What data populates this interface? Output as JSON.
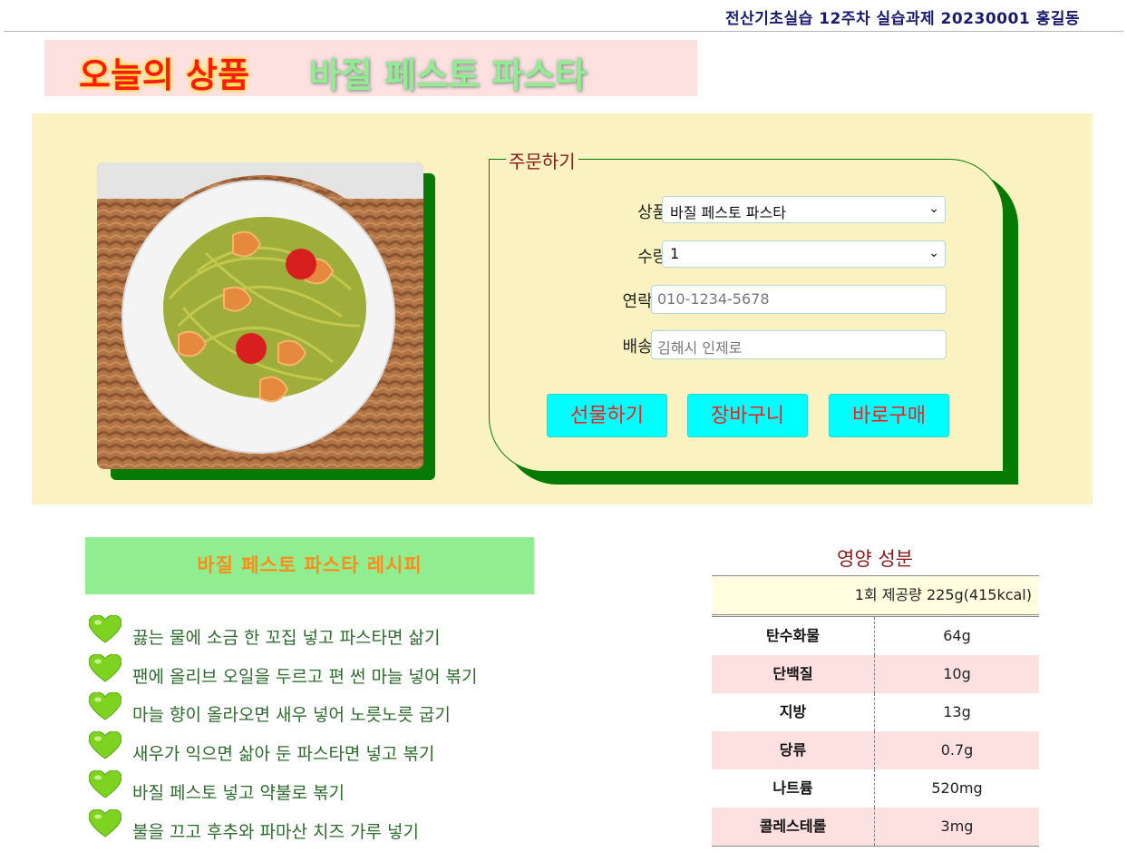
{
  "header": {
    "text": "전산기초실습 12주차 실습과제 20230001 홍길동"
  },
  "title": {
    "prefix": "오늘의 상품",
    "product": "바질 페스토 파스타"
  },
  "order": {
    "legend": "주문하기",
    "product_label": "상품 :",
    "product_value": "바질 페스토 파스타",
    "qty_label": "수량 :",
    "qty_value": "1",
    "contact_label": "연락처 :",
    "contact_placeholder": "010-1234-5678",
    "address_label": "배송지 :",
    "address_placeholder": "김해시 인제로",
    "buttons": {
      "gift": "선물하기",
      "cart": "장바구니",
      "buy": "바로구매"
    }
  },
  "recipe": {
    "title": "바질 페스토 파스타 레시피",
    "steps": [
      "끓는 물에 소금 한 꼬집 넣고 파스타면 삶기",
      "팬에 올리브 오일을 두르고 편 썬 마늘 넣어 볶기",
      "마늘 향이 올라오면 새우 넣어 노릇노릇 굽기",
      "새우가 익으면 삶아 둔 파스타면 넣고 볶기",
      "바질 페스토 넣고 약불로 볶기",
      "불을 끄고 후추와 파마산 치즈 가루 넣기"
    ]
  },
  "nutrition": {
    "caption": "영양 성분",
    "serving": "1회 제공량 225g(415kcal)",
    "rows": [
      {
        "name": "탄수화물",
        "value": "64g"
      },
      {
        "name": "단백질",
        "value": "10g"
      },
      {
        "name": "지방",
        "value": "13g"
      },
      {
        "name": "당류",
        "value": "0.7g"
      },
      {
        "name": "나트륨",
        "value": "520mg"
      },
      {
        "name": "콜레스테롤",
        "value": "3mg"
      }
    ]
  },
  "colors": {
    "accent_green": "#057a05",
    "panel_bg": "#faf3c1",
    "button_bg": "#00ffff",
    "button_text": "#ff1a1a"
  }
}
